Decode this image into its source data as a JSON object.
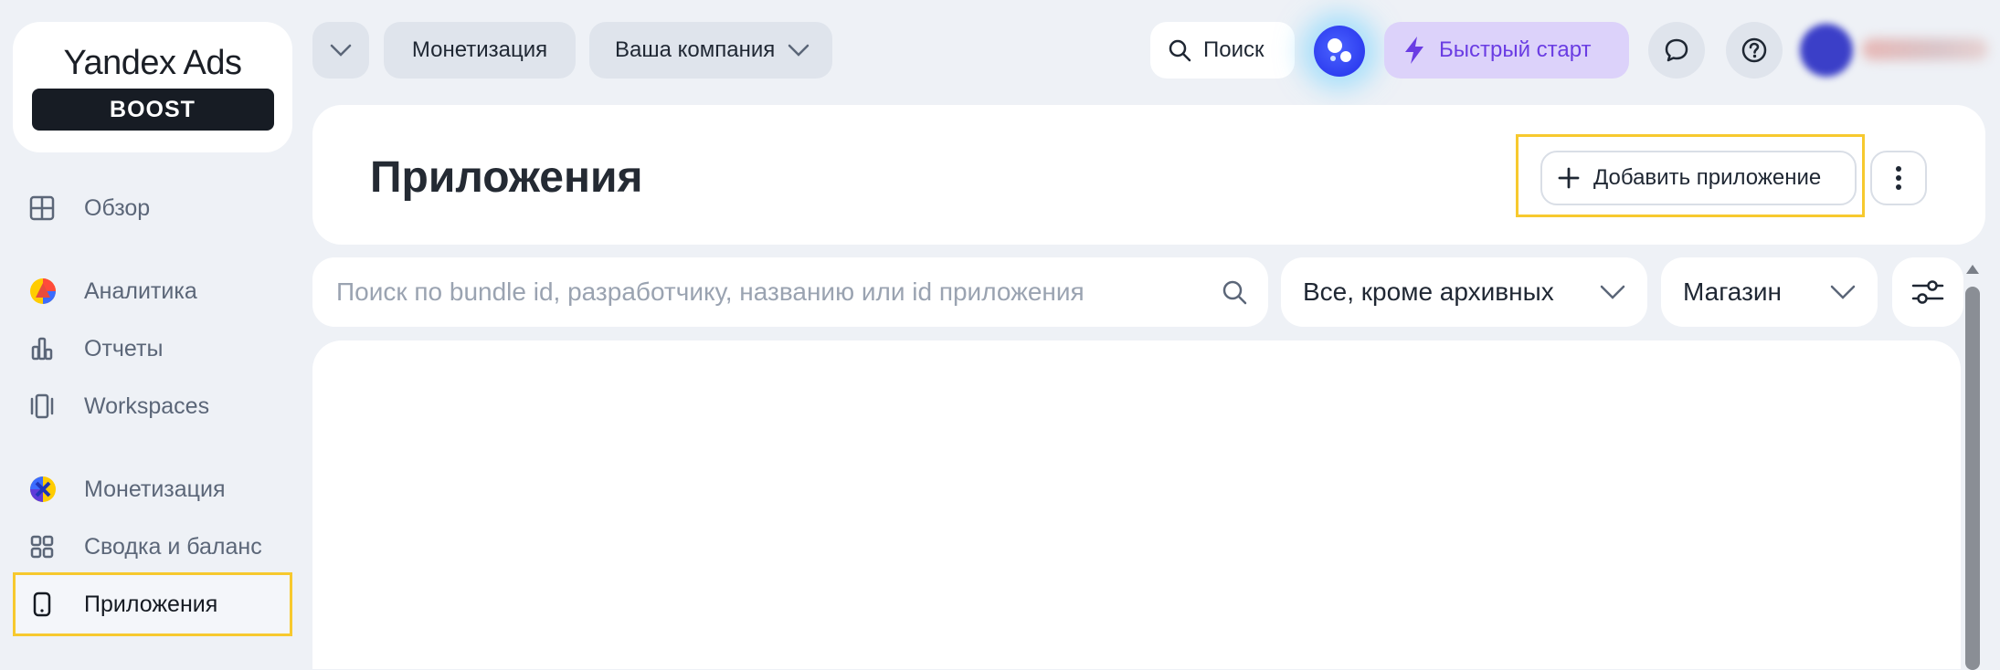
{
  "brand": {
    "name": "Yandex Ads",
    "badge": "BOOST"
  },
  "sidebar": {
    "items": [
      {
        "label": "Обзор",
        "icon": "grid-icon"
      },
      {
        "label": "Аналитика",
        "icon": "analytics-logo-icon"
      },
      {
        "label": "Отчеты",
        "icon": "bar-chart-icon"
      },
      {
        "label": "Workspaces",
        "icon": "workspaces-icon"
      },
      {
        "label": "Монетизация",
        "icon": "monetization-logo-icon"
      },
      {
        "label": "Сводка и баланс",
        "icon": "four-squares-icon"
      },
      {
        "label": "Приложения",
        "icon": "phone-icon",
        "active": true
      }
    ]
  },
  "topbar": {
    "section": "Монетизация",
    "company": "Ваша компания",
    "search_label": "Поиск",
    "quick_start": "Быстрый старт"
  },
  "page": {
    "title": "Приложения",
    "add_button": "Добавить приложение"
  },
  "filters": {
    "search_placeholder": "Поиск по bundle id, разработчику, названию или id приложения",
    "status_value": "Все, кроме архивных",
    "store_value": "Магазин"
  },
  "colors": {
    "background": "#eef1f6",
    "accent_purple": "#6a3ce3",
    "highlight_yellow": "#f7c92e",
    "ai_blue": "#2e3ef0"
  }
}
